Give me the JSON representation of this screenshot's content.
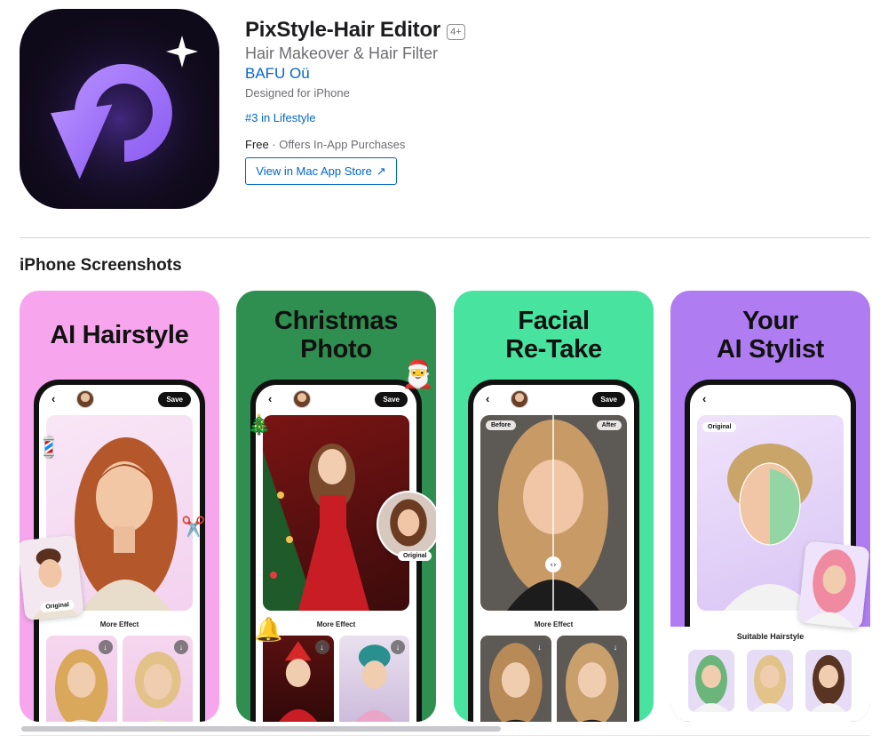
{
  "app": {
    "title": "PixStyle-Hair Editor",
    "age_rating": "4+",
    "subtitle": "Hair Makeover & Hair Filter",
    "developer": "BAFU Oü",
    "designed_for": "Designed for iPhone",
    "rank": "#3 in Lifestyle",
    "price": "Free",
    "in_app": " · Offers In-App Purchases",
    "view_button": "View in Mac App Store",
    "view_button_icon": "↗",
    "icon_name": "refresh-loop-sparkle-icon"
  },
  "section": {
    "title": "iPhone Screenshots"
  },
  "screenshots": [
    {
      "heading_line1": "AI Hairstyle",
      "heading_line2": "",
      "save": "Save",
      "more_effect": "More Effect",
      "original": "Original",
      "bg": "#f7a6ee"
    },
    {
      "heading_line1": "Christmas",
      "heading_line2": "Photo",
      "save": "Save",
      "more_effect": "More Effect",
      "original": "Original",
      "bg": "#2f8f50"
    },
    {
      "heading_line1": "Facial",
      "heading_line2": "Re-Take",
      "save": "Save",
      "before": "Before",
      "after": "After",
      "more_effect": "More Effect",
      "bg": "#49e3a0"
    },
    {
      "heading_line1": "Your",
      "heading_line2": "AI Stylist",
      "original": "Original",
      "suitable": "Suitable Hairstyle",
      "bg": "#b07cf2"
    }
  ],
  "colors": {
    "link": "#0066cc",
    "icon_purple": "#9b6cf7",
    "icon_bg": "#0f0a1a"
  }
}
